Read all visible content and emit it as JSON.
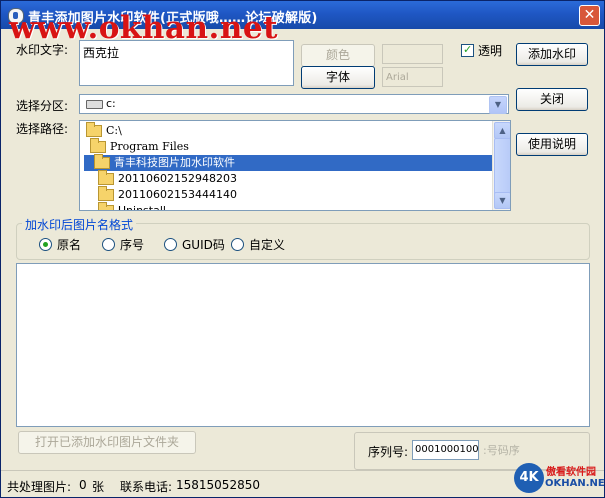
{
  "window": {
    "title": "青丰添加图片水印软件(正式版哦……论坛破解版)",
    "close_glyph": "✕"
  },
  "overlay_watermark": "www.okhan.net",
  "watermark_text": {
    "label": "水印文字:",
    "value": "西克拉"
  },
  "controls": {
    "color_button": "颜色",
    "font_button": "字体",
    "font_name": "Arial",
    "transparent_label": "透明",
    "transparent_checked": true,
    "add_watermark_button": "添加水印",
    "close_button": "关闭",
    "help_button": "使用说明"
  },
  "partition": {
    "label": "选择分区:",
    "value": "c:"
  },
  "path": {
    "label": "选择路径:",
    "items": [
      {
        "name": "C:\\",
        "selected": false
      },
      {
        "name": "Program Files",
        "selected": false
      },
      {
        "name": "青丰科技图片加水印软件",
        "selected": true
      },
      {
        "name": "20110602152948203",
        "selected": false
      },
      {
        "name": "20110602153444140",
        "selected": false
      },
      {
        "name": "Uninstall",
        "selected": false
      }
    ]
  },
  "naming_format": {
    "legend": "加水印后图片名格式",
    "options": [
      {
        "label": "原名",
        "checked": true
      },
      {
        "label": "序号",
        "checked": false
      },
      {
        "label": "GUID码",
        "checked": false
      },
      {
        "label": "自定义",
        "checked": false
      }
    ]
  },
  "bottom": {
    "open_folder_button": "打开已添加水印图片文件夹",
    "serial_label": "序列号:",
    "serial_value": "00010001000",
    "serial_suffix": ":号码序"
  },
  "status": {
    "processed_label": "共处理图片:",
    "processed_count": "0",
    "processed_unit": "张",
    "phone_label": "联系电话:",
    "phone": "15815052850"
  },
  "logo": {
    "mark": "4K",
    "cn": "傲看软件园",
    "en": "OKHAN.NET"
  },
  "colors": {
    "accent": "#316ac5",
    "watermark_red": "#d81414",
    "titlebar": "#1f57c4"
  }
}
